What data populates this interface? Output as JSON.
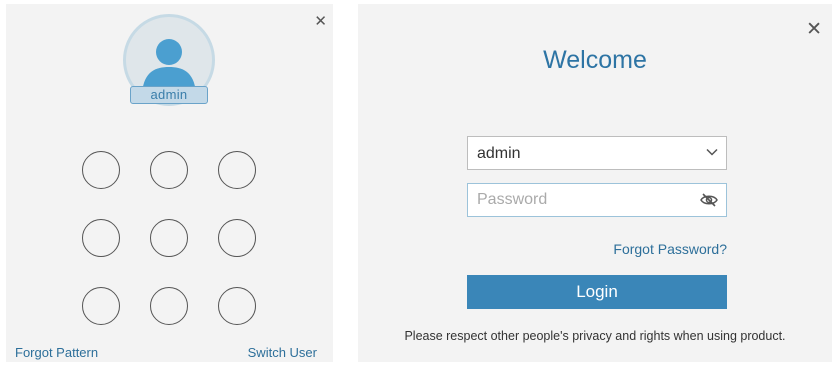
{
  "pattern_login": {
    "close_icon": "close-icon",
    "avatar_icon": "user-avatar-icon",
    "username": "admin",
    "grid_dot_count": 9,
    "forgot_pattern": "Forgot Pattern",
    "switch_user": "Switch User"
  },
  "password_login": {
    "close_icon": "close-icon",
    "title": "Welcome",
    "user_select": {
      "value": "admin",
      "icon": "chevron-down-icon"
    },
    "password": {
      "placeholder": "Password",
      "icon": "eye-slash-icon"
    },
    "forgot_password": "Forgot Password?",
    "login_button": "Login",
    "notice": "Please respect other people's privacy and rights when using product."
  },
  "colors": {
    "accent": "#3a86b8",
    "link": "#2d6f9a",
    "panel_bg": "#f3f3f3"
  }
}
